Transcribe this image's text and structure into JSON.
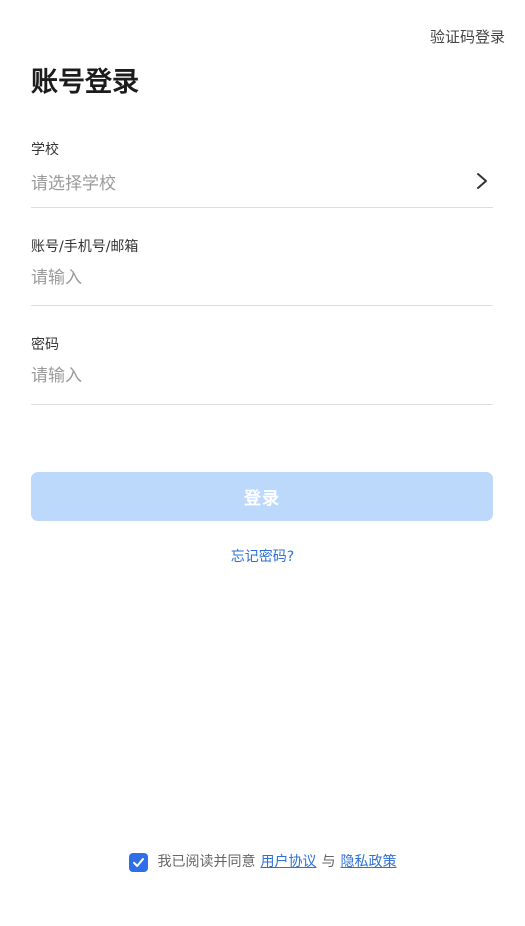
{
  "header": {
    "switch_mode_label": "验证码登录",
    "title": "账号登录"
  },
  "form": {
    "school": {
      "label": "学校",
      "placeholder": "请选择学校",
      "icon": "chevron-right-icon"
    },
    "account": {
      "label": "账号/手机号/邮箱",
      "placeholder": "请输入"
    },
    "password": {
      "label": "密码",
      "placeholder": "请输入"
    },
    "login_label": "登录",
    "forgot_label": "忘记密码?"
  },
  "agreement": {
    "checked": true,
    "prefix": "我已阅读并同意",
    "user_agreement": "用户协议",
    "connector": "与",
    "privacy_policy": "隐私政策",
    "icon": "checkmark-icon"
  },
  "colors": {
    "accent": "#2e6ee8",
    "link": "#2f6fd6",
    "login_disabled_bg": "#bcd8fb"
  }
}
